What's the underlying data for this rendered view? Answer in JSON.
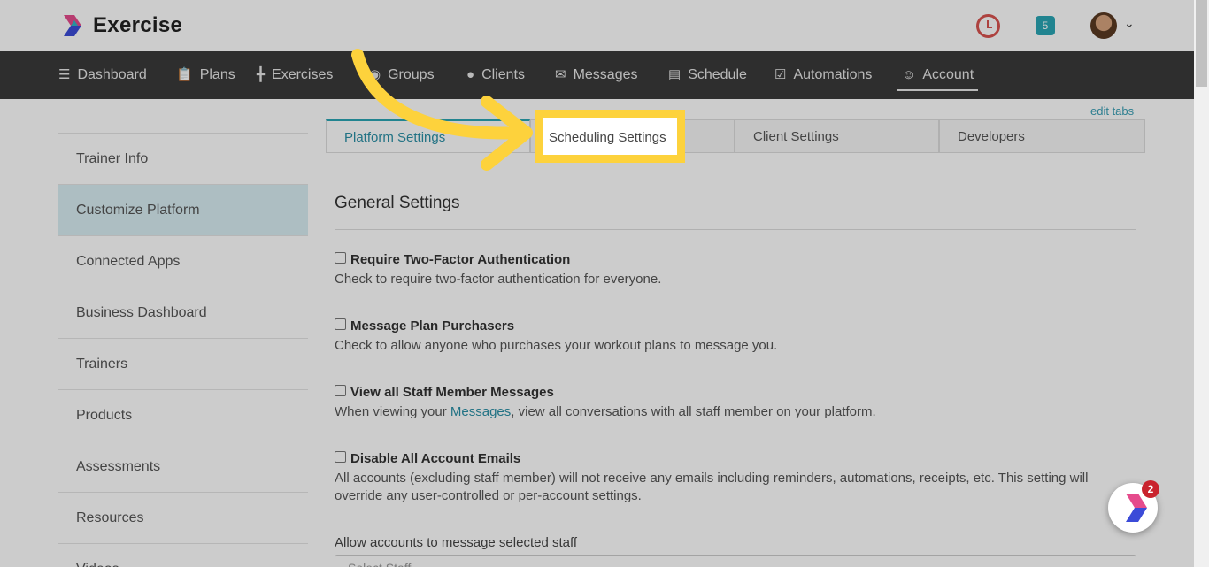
{
  "header": {
    "brand": "Exercise",
    "notification_count": "5"
  },
  "nav": {
    "items": [
      {
        "label": "Dashboard",
        "icon": "list-icon"
      },
      {
        "label": "Plans",
        "icon": "clipboard-icon"
      },
      {
        "label": "Exercises",
        "icon": "dumbbell-icon"
      },
      {
        "label": "Groups",
        "icon": "users-icon"
      },
      {
        "label": "Clients",
        "icon": "user-icon"
      },
      {
        "label": "Messages",
        "icon": "envelope-icon"
      },
      {
        "label": "Schedule",
        "icon": "book-icon"
      },
      {
        "label": "Automations",
        "icon": "check-square-icon"
      },
      {
        "label": "Account",
        "icon": "user-circle-icon",
        "active": true
      }
    ]
  },
  "sidebar": {
    "items": [
      {
        "label": "Trainer Info"
      },
      {
        "label": "Customize Platform",
        "active": true
      },
      {
        "label": "Connected Apps"
      },
      {
        "label": "Business Dashboard"
      },
      {
        "label": "Trainers"
      },
      {
        "label": "Products"
      },
      {
        "label": "Assessments"
      },
      {
        "label": "Resources"
      },
      {
        "label": "Videos"
      }
    ]
  },
  "tabs": {
    "edit_label": "edit tabs",
    "items": [
      {
        "label": "Platform Settings",
        "active": true
      },
      {
        "label": "Scheduling Settings"
      },
      {
        "label": "Client Settings"
      },
      {
        "label": "Developers"
      }
    ]
  },
  "content": {
    "section_title": "General Settings",
    "settings": [
      {
        "title": "Require Two-Factor Authentication",
        "desc": "Check to require two-factor authentication for everyone."
      },
      {
        "title": "Message Plan Purchasers",
        "desc": "Check to allow anyone who purchases your workout plans to message you."
      },
      {
        "title": "View all Staff Member Messages",
        "desc_before": "When viewing your ",
        "desc_link": "Messages",
        "desc_after": ", view all conversations with all staff member on your platform."
      },
      {
        "title": "Disable All Account Emails",
        "desc": "All accounts (excluding staff member) will not receive any emails including reminders, automations, receipts, etc. This setting will override any user-controlled or per-account settings."
      }
    ],
    "select_label": "Allow accounts to message selected staff",
    "select_placeholder": "Select Staff"
  },
  "highlight": {
    "label": "Scheduling Settings",
    "color": "#fdd23c"
  },
  "widget": {
    "badge": "2"
  },
  "colors": {
    "nav_bg": "#3a3a3a",
    "accent": "#2aa6b5",
    "active_sidebar": "#d9eef3"
  }
}
